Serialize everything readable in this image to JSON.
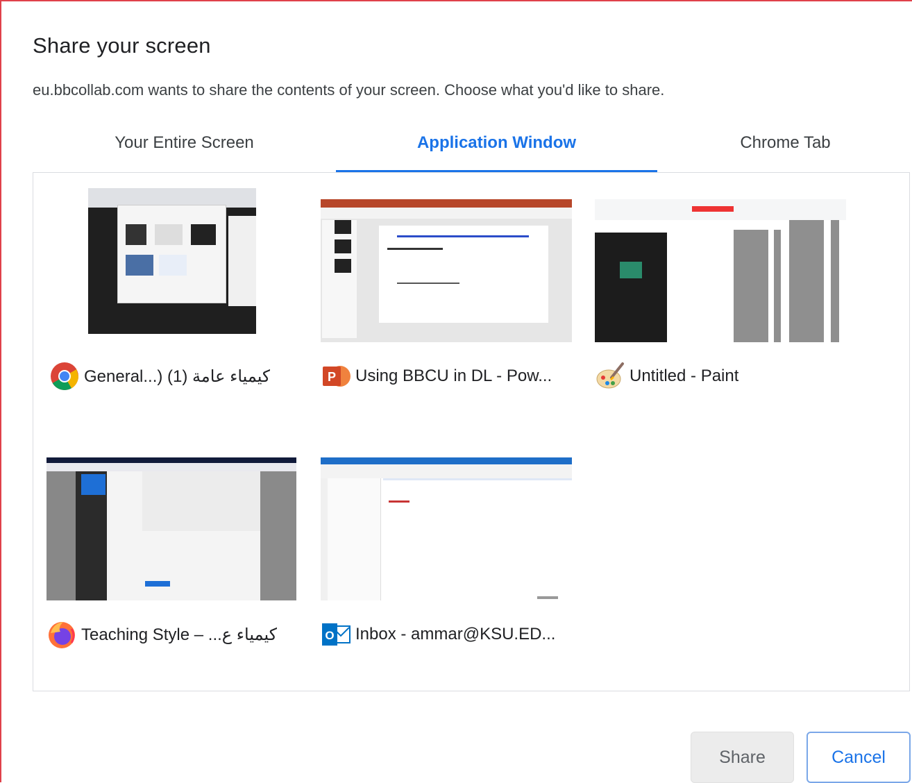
{
  "dialog": {
    "title": "Share your screen",
    "subtitle": "eu.bbcollab.com wants to share the contents of your screen. Choose what you'd like to share."
  },
  "tabs": [
    {
      "label": "Your Entire Screen",
      "active": false
    },
    {
      "label": "Application Window",
      "active": true
    },
    {
      "label": "Chrome Tab",
      "active": false
    }
  ],
  "windows": [
    {
      "label": "General...) (1) كيمياء عامة",
      "icon": "chrome-icon"
    },
    {
      "label": "Using BBCU in DL - Pow...",
      "icon": "powerpoint-icon"
    },
    {
      "label": "Untitled - Paint",
      "icon": "paint-icon"
    },
    {
      "label": "Teaching Style – ...كيمياء ع",
      "icon": "firefox-icon"
    },
    {
      "label": "Inbox - ammar@KSU.ED...",
      "icon": "outlook-icon"
    }
  ],
  "buttons": {
    "share": "Share",
    "cancel": "Cancel"
  },
  "colors": {
    "accent": "#1a73e8",
    "border_highlight": "#e0414a"
  }
}
